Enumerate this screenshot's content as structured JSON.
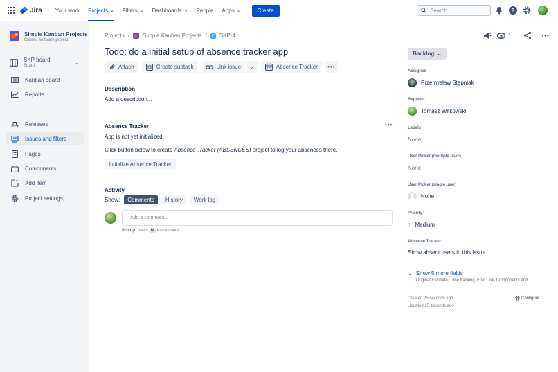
{
  "topnav": {
    "logo_text": "Jira",
    "items": [
      {
        "label": "Your work",
        "caret": false
      },
      {
        "label": "Projects",
        "caret": true,
        "active": true
      },
      {
        "label": "Filters",
        "caret": true
      },
      {
        "label": "Dashboards",
        "caret": true
      },
      {
        "label": "People",
        "caret": false
      },
      {
        "label": "Apps",
        "caret": true
      }
    ],
    "create_label": "Create",
    "search_placeholder": "Search",
    "icons": [
      "notifications-icon",
      "help-icon",
      "settings-icon",
      "profile-avatar"
    ]
  },
  "sidebar": {
    "project_name": "Simple Kanban Projects",
    "project_type": "Classic software project",
    "board_name": "SKP board",
    "board_sub": "Board",
    "items_top": [
      "Kanban board",
      "Reports"
    ],
    "items_bottom": [
      "Releases",
      "Issues and filters",
      "Pages",
      "Components",
      "Add item",
      "Project settings"
    ],
    "active_item": "Issues and filters"
  },
  "breadcrumb": {
    "projects": "Projects",
    "sep": "/",
    "project": "Simple Kanban Projects",
    "issue_key": "SKP-4"
  },
  "issue": {
    "title": "Todo: do a initial setup of absence tracker app",
    "toolbar": {
      "attach": "Attach",
      "create_subtask": "Create subtask",
      "link_issue": "Link issue",
      "absence_tracker": "Absence Tracker"
    },
    "description_title": "Description",
    "description_placeholder": "Add a description...",
    "absence_title": "Absence Tracker",
    "absence_status": "App is not yet initialized.",
    "absence_text_pre": "Click button below to create ",
    "absence_text_em": "Absence Tracker (ABSENCES)",
    "absence_text_post": " project to log your absences there.",
    "init_button": "Initialize Absence Tracker",
    "activity_title": "Activity",
    "show_label": "Show:",
    "tabs": [
      "Comments",
      "History",
      "Work log"
    ],
    "comment_placeholder": "Add a comment...",
    "protip_bold": "Pro tip:",
    "protip_pre": "press",
    "protip_key": "M",
    "protip_post": "to comment"
  },
  "header_actions": {
    "watchers": "1"
  },
  "details": {
    "status": "Backlog",
    "assignee_label": "Assignee",
    "assignee": "Przemysław Stępniak",
    "reporter_label": "Reporter",
    "reporter": "Tomasz Witkowski",
    "labels_label": "Labels",
    "labels_value": "None",
    "user_picker_multi_label": "User Picker (multiple users)",
    "user_picker_multi_value": "None",
    "user_picker_single_label": "User Picker (single user)",
    "user_picker_single_value": "None",
    "priority_label": "Priority",
    "priority": "Medium",
    "absence_tracker_label": "Absence Tracker",
    "absence_tracker_value": "Show absent users in this issue",
    "show_more": "Show 5 more fields",
    "show_more_sub": "Original Estimate, Time tracking, Epic Link, Components and...",
    "created": "Created 25 seconds ago",
    "updated": "Updated 25 seconds ago",
    "configure": "Configure"
  }
}
